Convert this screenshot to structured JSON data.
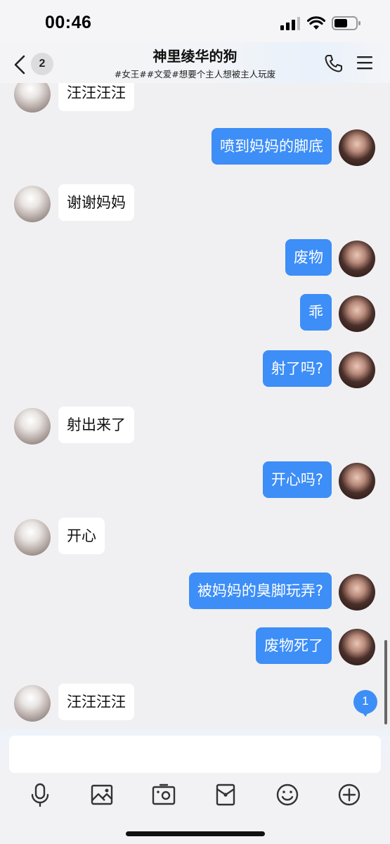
{
  "status_bar": {
    "time": "00:46"
  },
  "header": {
    "unread_count": "2",
    "title": "神里绫华的狗",
    "subtitle": "#女王##文爱#想要个主人想被主人玩废"
  },
  "messages": [
    {
      "side": "them",
      "text": "汪汪汪汪"
    },
    {
      "side": "me",
      "text": "喷到妈妈的脚底"
    },
    {
      "side": "them",
      "text": "谢谢妈妈"
    },
    {
      "side": "me",
      "text": "废物"
    },
    {
      "side": "me",
      "text": "乖"
    },
    {
      "side": "me",
      "text": "射了吗?"
    },
    {
      "side": "them",
      "text": "射出来了"
    },
    {
      "side": "me",
      "text": "开心吗?"
    },
    {
      "side": "them",
      "text": "开心"
    },
    {
      "side": "me",
      "text": "被妈妈的臭脚玩弄?"
    },
    {
      "side": "me",
      "text": "废物死了"
    },
    {
      "side": "them",
      "text": "汪汪汪汪"
    }
  ],
  "new_message_badge": "1",
  "input": {
    "value": "",
    "placeholder": ""
  },
  "toolbar": [
    "mic-icon",
    "image-icon",
    "camera-icon",
    "red-packet-icon",
    "emoji-icon",
    "plus-icon"
  ],
  "colors": {
    "my_bubble": "#3d8ef7",
    "their_bubble": "#ffffff",
    "background": "#f0f0f2"
  }
}
